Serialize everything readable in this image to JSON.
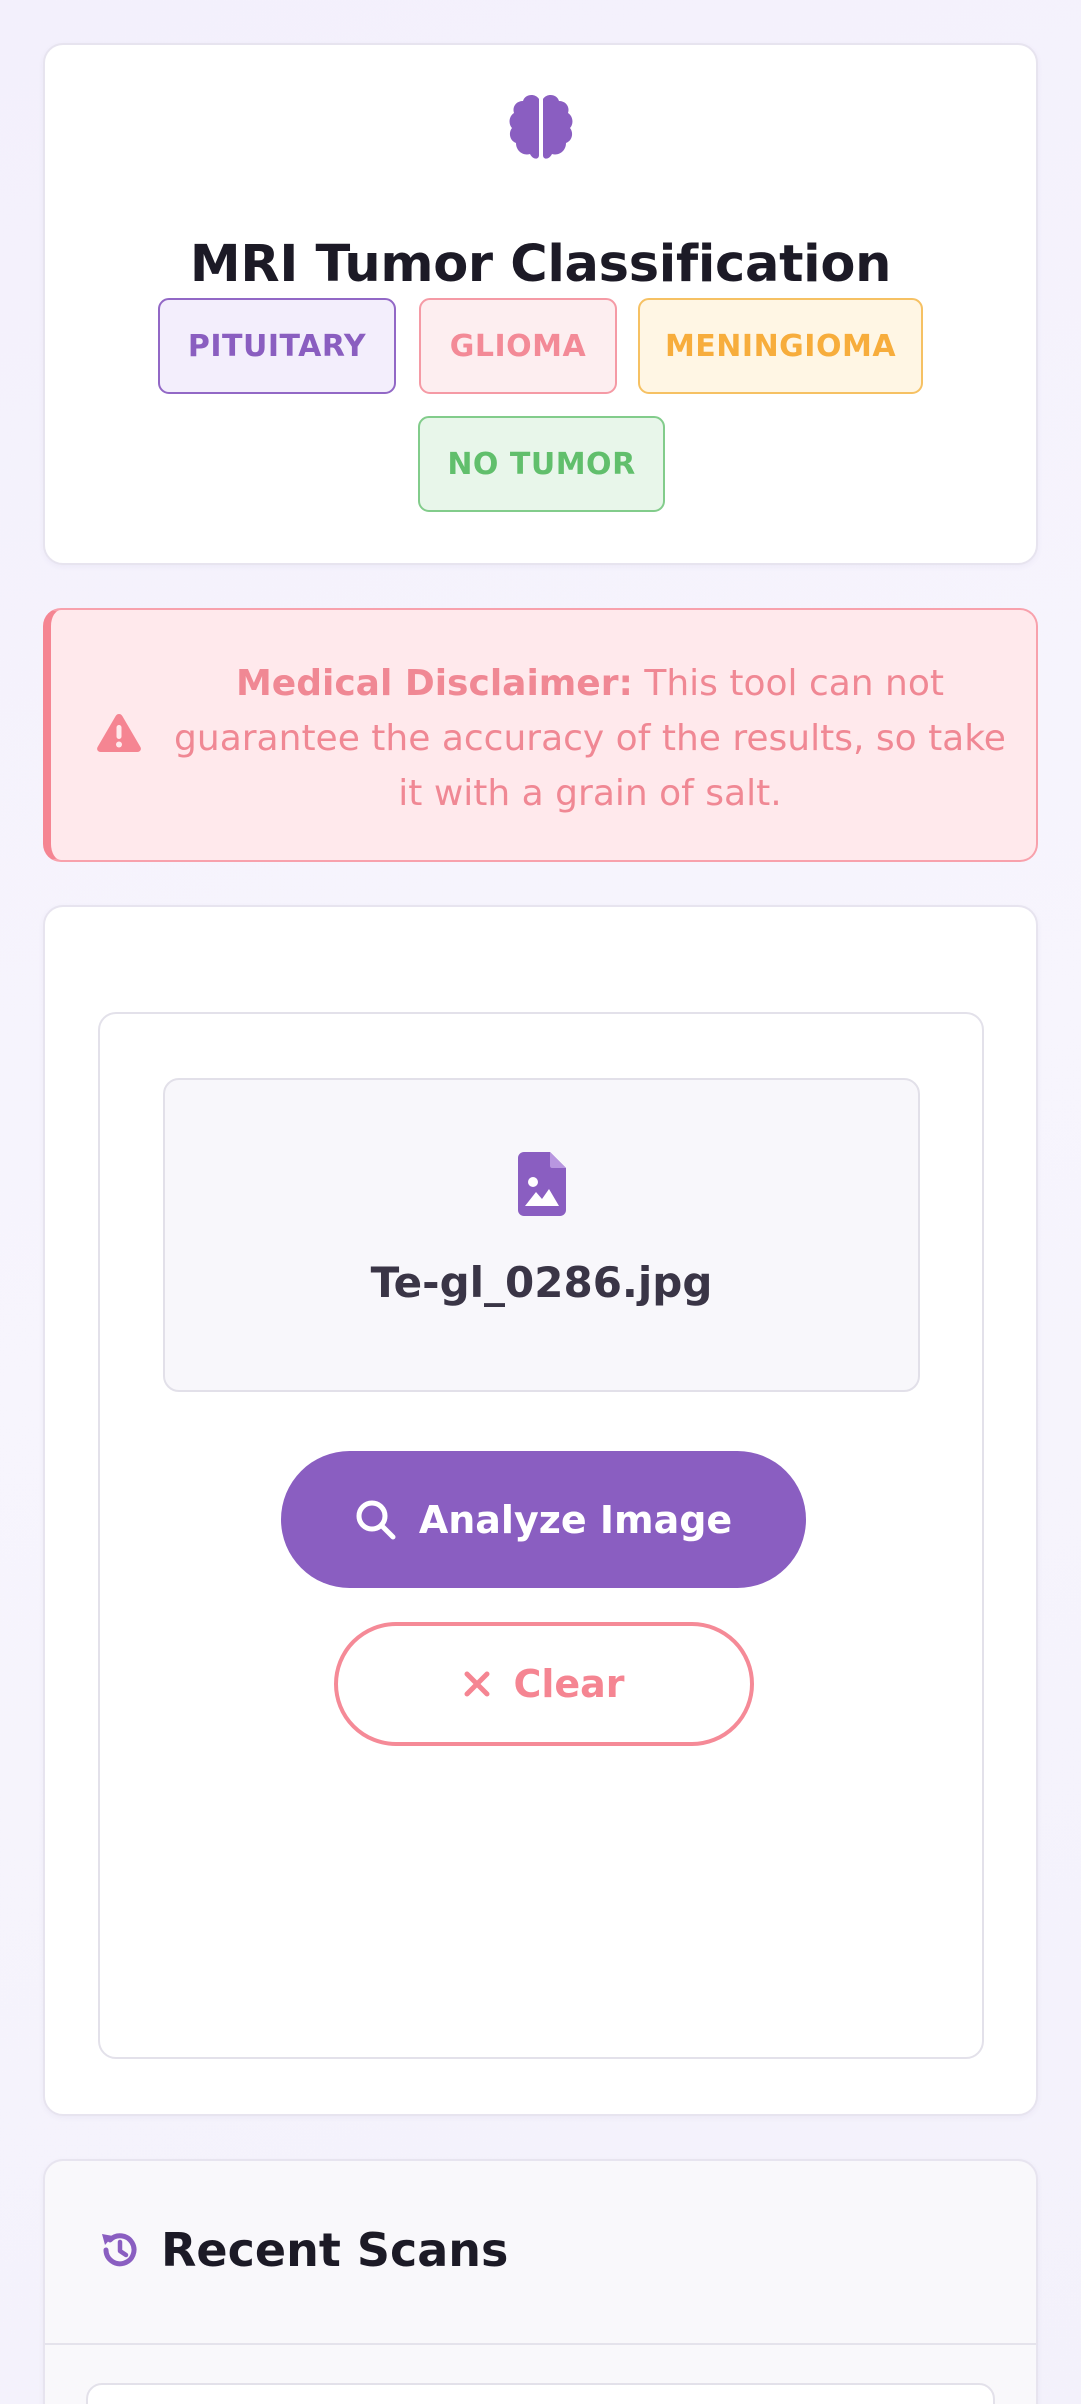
{
  "header": {
    "icon": "brain-icon",
    "title": "MRI Tumor Classification",
    "badges": [
      {
        "label": "PITUITARY",
        "color": "#8a5ec0"
      },
      {
        "label": "GLIOMA",
        "color": "#f38a97"
      },
      {
        "label": "MENINGIOMA",
        "color": "#f7ad3c"
      },
      {
        "label": "NO TUMOR",
        "color": "#61bf6c"
      }
    ]
  },
  "disclaimer": {
    "icon": "warning-icon",
    "heading": "Medical Disclaimer:",
    "text": "This tool can not guarantee the accuracy of the results, so take it with a grain of salt."
  },
  "upload": {
    "file_icon": "image-file-icon",
    "file_name": "Te-gl_0286.jpg",
    "analyze_label": "Analyze Image",
    "analyze_icon": "search-icon",
    "clear_label": "Clear",
    "clear_icon": "close-icon"
  },
  "recent": {
    "icon": "history-icon",
    "title": "Recent Scans"
  },
  "colors": {
    "accent": "#8a5ec1",
    "danger": "#f58592",
    "warning": "#f7ad3c",
    "success": "#61bf6c"
  }
}
